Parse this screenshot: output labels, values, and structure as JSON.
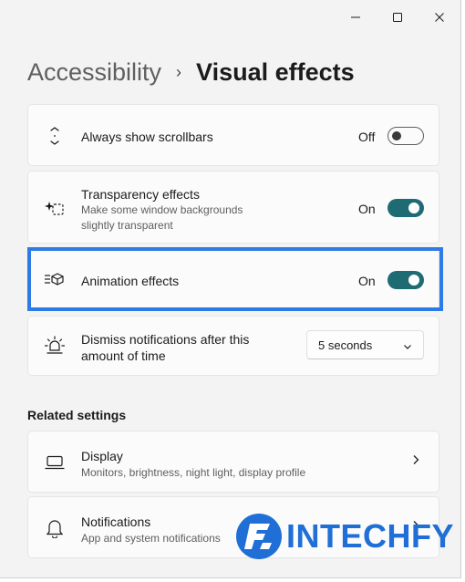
{
  "header": {
    "parent": "Accessibility",
    "separator": "›",
    "current": "Visual effects"
  },
  "settings": [
    {
      "name": "always-show-scrollbars",
      "icon": "scroll-arrows-icon",
      "title": "Always show scrollbars",
      "state": "Off",
      "toggle_on": false
    },
    {
      "name": "transparency-effects",
      "icon": "transparency-icon",
      "title": "Transparency effects",
      "description": [
        "Make some window backgrounds",
        "slightly transparent"
      ],
      "state": "On",
      "toggle_on": true
    },
    {
      "name": "animation-effects",
      "icon": "animation-icon",
      "title": "Animation effects",
      "state": "On",
      "toggle_on": true
    },
    {
      "name": "dismiss-notifications",
      "icon": "sun-bell-icon",
      "title": [
        "Dismiss notifications after this",
        "amount of time"
      ],
      "dropdown_value": "5 seconds"
    }
  ],
  "related": {
    "heading": "Related settings",
    "items": [
      {
        "name": "display",
        "icon": "laptop-icon",
        "title": "Display",
        "description": "Monitors, brightness, night light, display profile"
      },
      {
        "name": "notifications",
        "icon": "bell-icon",
        "title": "Notifications",
        "description": "App and system notifications"
      }
    ]
  },
  "watermark": {
    "text": "INTECHFY"
  },
  "colors": {
    "toggle_on": "#1e6b74",
    "highlight_border": "#2f7be5",
    "accent_bar": "#c42b1c",
    "brand": "#1f6fd6"
  }
}
